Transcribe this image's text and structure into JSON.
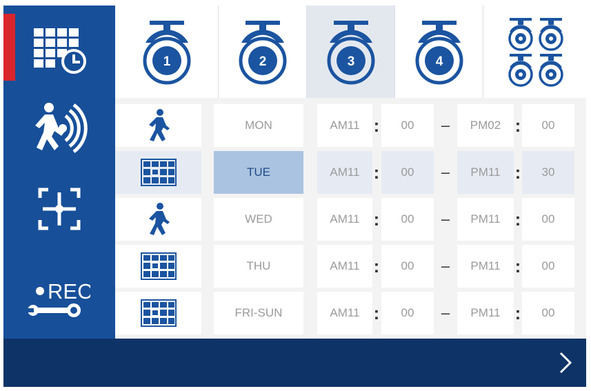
{
  "colors": {
    "sidebar": "#174f99",
    "footer": "#0e3366",
    "accent_red": "#d9262c",
    "icon_blue": "#1b54a0",
    "selected_day": "#aac3e0"
  },
  "sidebar": {
    "items": [
      {
        "icon": "schedule-calendar-icon",
        "active": true
      },
      {
        "icon": "motion-detection-icon",
        "active": false
      },
      {
        "icon": "crosshair-focus-icon",
        "active": false
      },
      {
        "icon": "record-settings-icon",
        "label": "REC",
        "active": false
      }
    ]
  },
  "cameras": {
    "tabs": [
      {
        "label": "1",
        "icon": "camera-icon"
      },
      {
        "label": "2",
        "icon": "camera-icon"
      },
      {
        "label": "3",
        "icon": "camera-icon",
        "selected": true
      },
      {
        "label": "4",
        "icon": "camera-icon"
      },
      {
        "label": "",
        "icon": "all-cameras-icon"
      }
    ]
  },
  "schedule": {
    "rows": [
      {
        "mode": "walking-person-icon",
        "day": "MON",
        "start_period": "AM11",
        "start_min": "00",
        "end_period": "PM02",
        "end_min": "00"
      },
      {
        "mode": "grid-recording-icon",
        "day": "TUE",
        "start_period": "AM11",
        "start_min": "00",
        "end_period": "PM11",
        "end_min": "30",
        "selected": true
      },
      {
        "mode": "walking-person-icon",
        "day": "WED",
        "start_period": "AM11",
        "start_min": "00",
        "end_period": "PM11",
        "end_min": "00"
      },
      {
        "mode": "grid-recording-icon",
        "day": "THU",
        "start_period": "AM11",
        "start_min": "00",
        "end_period": "PM11",
        "end_min": "00"
      },
      {
        "mode": "grid-recording-icon",
        "day": "FRI-SUN",
        "start_period": "AM11",
        "start_min": "00",
        "end_period": "PM11",
        "end_min": "00"
      }
    ],
    "colon": ":",
    "dash": "–"
  },
  "footer": {
    "next_icon": "chevron-right-icon"
  }
}
